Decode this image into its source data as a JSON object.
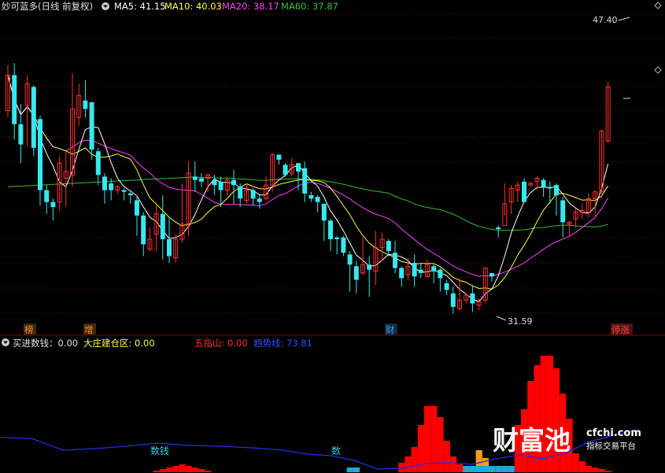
{
  "top_legend": {
    "title": "妙可蓝多(日线 前复权)",
    "ma5": "MA5: 41.15",
    "ma10": "MA10: 40.03",
    "ma20": "MA20: 38.17",
    "ma60": "MA60: 37.87"
  },
  "price_labels": {
    "high": "47.40",
    "low": "31.59"
  },
  "markers": [
    {
      "text": "榜",
      "color": "#ff8c2a"
    },
    {
      "text": "增",
      "color": "#ff8c2a"
    },
    {
      "text": "财",
      "color": "#3aa0ff"
    },
    {
      "text": "停涨",
      "color": "#ff4040"
    }
  ],
  "indicator_legend": {
    "main": "买进数钱：0.00",
    "zhuang": "大庄建仓区: 0.00",
    "wuzhi": "五指山: 0.00",
    "trend": "趋势线: 73.81"
  },
  "indicator_labels": {
    "shuqian1": "数钱",
    "shuqian2": "数"
  },
  "watermark": {
    "logo": "财富池",
    "site": "cfchi.com",
    "slogan": "指标交易平台"
  },
  "colors": {
    "up": "#ff3030",
    "down": "#36e8f0",
    "ma5": "#ffffff",
    "ma10": "#ffff40",
    "ma20": "#ff40ff",
    "ma60": "#30c030",
    "grid": "#8b0000",
    "trend": "#2030e0"
  },
  "chart_data": {
    "type": "candlestick",
    "ylim": [
      30.5,
      48.5
    ],
    "candles": [
      [
        42.8,
        44.9,
        42.4,
        45.5
      ],
      [
        44.9,
        42.0,
        41.1,
        45.6
      ],
      [
        42.0,
        40.8,
        39.7,
        43.2
      ],
      [
        43.1,
        44.4,
        40.7,
        44.9
      ],
      [
        44.2,
        40.6,
        40.1,
        44.3
      ],
      [
        42.3,
        38.1,
        37.2,
        42.5
      ],
      [
        38.1,
        37.4,
        36.7,
        38.4
      ],
      [
        37.4,
        37.1,
        36.3,
        37.6
      ],
      [
        37.4,
        39.7,
        36.9,
        40.1
      ],
      [
        38.8,
        39.2,
        37.1,
        40.4
      ],
      [
        39.0,
        42.9,
        38.3,
        45.0
      ],
      [
        42.4,
        43.7,
        41.9,
        44.4
      ],
      [
        43.4,
        42.9,
        42.4,
        44.6
      ],
      [
        43.3,
        40.5,
        39.9,
        43.3
      ],
      [
        40.4,
        39.0,
        38.4,
        40.6
      ],
      [
        38.9,
        38.1,
        37.3,
        39.1
      ],
      [
        38.5,
        38.1,
        37.5,
        38.8
      ],
      [
        38.1,
        38.3,
        37.9,
        38.4
      ],
      [
        38.1,
        38.0,
        37.5,
        38.2
      ],
      [
        37.9,
        37.8,
        37.3,
        38.1
      ],
      [
        37.5,
        36.6,
        35.4,
        37.7
      ],
      [
        36.6,
        34.9,
        34.2,
        36.8
      ],
      [
        34.6,
        35.2,
        34.5,
        35.9
      ],
      [
        35.5,
        36.7,
        34.5,
        37.2
      ],
      [
        36.7,
        35.2,
        34.0,
        37.8
      ],
      [
        35.2,
        34.2,
        33.8,
        36.5
      ],
      [
        34.1,
        35.2,
        33.8,
        35.5
      ],
      [
        35.2,
        36.1,
        35.0,
        38.5
      ],
      [
        36.0,
        39.1,
        35.4,
        39.8
      ],
      [
        38.9,
        38.7,
        38.0,
        39.8
      ],
      [
        38.8,
        38.6,
        38.3,
        39.1
      ],
      [
        38.8,
        39.0,
        38.0,
        39.1
      ],
      [
        38.7,
        38.4,
        37.8,
        39.0
      ],
      [
        38.6,
        38.1,
        37.1,
        38.9
      ],
      [
        38.1,
        38.7,
        37.8,
        38.9
      ],
      [
        38.7,
        38.4,
        37.3,
        39.3
      ],
      [
        38.3,
        37.6,
        37.1,
        38.5
      ],
      [
        37.5,
        38.1,
        37.3,
        38.5
      ],
      [
        38.1,
        37.6,
        37.2,
        38.2
      ],
      [
        37.6,
        37.4,
        37.0,
        37.8
      ],
      [
        37.6,
        38.4,
        37.5,
        38.9
      ],
      [
        38.4,
        40.2,
        38.0,
        40.3
      ],
      [
        40.2,
        39.9,
        39.6,
        40.2
      ],
      [
        39.6,
        39.0,
        38.9,
        39.7
      ],
      [
        39.1,
        39.6,
        38.9,
        40.0
      ],
      [
        39.7,
        39.2,
        38.1,
        39.5
      ],
      [
        39.4,
        37.9,
        37.4,
        39.8
      ],
      [
        37.8,
        37.6,
        37.4,
        38.0
      ],
      [
        37.7,
        37.4,
        36.8,
        37.8
      ],
      [
        37.3,
        36.3,
        35.1,
        37.2
      ],
      [
        36.3,
        35.2,
        34.5,
        36.4
      ],
      [
        35.3,
        35.2,
        34.3,
        35.4
      ],
      [
        35.3,
        34.4,
        34.2,
        35.4
      ],
      [
        34.3,
        33.7,
        32.1,
        34.5
      ],
      [
        33.6,
        32.8,
        32.0,
        33.9
      ],
      [
        33.2,
        33.7,
        33.1,
        35.3
      ],
      [
        33.7,
        33.4,
        31.8,
        34.2
      ],
      [
        33.3,
        34.7,
        32.5,
        35.7
      ],
      [
        34.7,
        35.2,
        33.9,
        35.6
      ],
      [
        35.1,
        34.5,
        34.2,
        35.2
      ],
      [
        34.4,
        33.5,
        33.2,
        35.1
      ],
      [
        33.5,
        32.9,
        32.4,
        33.6
      ],
      [
        33.1,
        33.6,
        32.8,
        34.1
      ],
      [
        33.8,
        33.0,
        32.4,
        34.3
      ],
      [
        33.4,
        33.2,
        32.9,
        33.8
      ],
      [
        33.0,
        33.7,
        32.9,
        34.0
      ],
      [
        33.6,
        33.3,
        32.6,
        33.7
      ],
      [
        33.4,
        32.9,
        32.1,
        33.5
      ],
      [
        32.6,
        32.2,
        31.9,
        32.8
      ],
      [
        32.0,
        31.2,
        30.8,
        32.4
      ],
      [
        31.1,
        31.6,
        31.0,
        32.9
      ],
      [
        31.6,
        31.9,
        31.4,
        32.0
      ],
      [
        32.0,
        31.4,
        30.9,
        32.5
      ],
      [
        31.3,
        31.5,
        31.0,
        31.7
      ],
      [
        31.6,
        33.5,
        31.4,
        33.5
      ],
      [
        33.2,
        33.0,
        32.7,
        33.2
      ],
      [
        35.9,
        35.8,
        35.3,
        36.0
      ],
      [
        36.0,
        37.3,
        36.6,
        38.5
      ],
      [
        37.4,
        38.2,
        36.7,
        38.4
      ],
      [
        38.1,
        38.4,
        37.4,
        38.6
      ],
      [
        38.6,
        37.4,
        37.5,
        38.8
      ],
      [
        38.4,
        38.5,
        38.3,
        38.6
      ],
      [
        38.6,
        38.8,
        38.1,
        38.9
      ],
      [
        38.7,
        38.3,
        37.7,
        38.8
      ],
      [
        38.3,
        38.2,
        37.3,
        38.6
      ],
      [
        38.4,
        37.8,
        36.6,
        38.5
      ],
      [
        37.5,
        36.2,
        35.3,
        37.7
      ],
      [
        36.1,
        36.2,
        35.4,
        36.3
      ],
      [
        36.4,
        36.8,
        35.9,
        37.0
      ],
      [
        36.8,
        36.9,
        36.4,
        37.3
      ],
      [
        36.8,
        37.6,
        36.5,
        37.9
      ],
      [
        37.6,
        38.0,
        36.5,
        38.1
      ],
      [
        38.0,
        41.6,
        37.6,
        41.7
      ],
      [
        41.0,
        44.2,
        40.9,
        44.5
      ]
    ],
    "ma5": [],
    "ma10": [],
    "ma20": [],
    "ma60": []
  },
  "indicator_data": {
    "red": [
      0,
      0,
      0,
      0,
      0,
      0,
      0,
      0,
      0,
      0,
      0,
      0,
      0,
      0,
      0,
      0,
      0,
      0,
      0,
      0,
      0,
      0,
      0,
      1,
      2,
      3,
      4,
      5,
      4,
      3,
      2,
      1,
      0,
      0,
      0,
      0,
      0,
      0,
      0,
      0,
      0,
      0,
      0,
      0,
      0,
      0,
      0,
      0,
      0,
      0,
      0,
      0,
      0,
      0,
      0,
      0,
      0,
      0,
      0,
      0,
      0,
      6,
      10,
      16,
      30,
      42,
      42,
      35,
      20,
      10,
      5,
      3,
      2,
      1,
      0,
      0,
      0,
      0,
      0,
      30,
      40,
      58,
      68,
      74,
      74,
      66,
      50,
      34,
      12,
      7,
      4,
      3,
      2,
      1,
      0,
      0,
      0,
      0,
      0,
      0,
      0
    ],
    "cyan": [
      0,
      0,
      0,
      0,
      0,
      0,
      0,
      0,
      0,
      0,
      0,
      0,
      0,
      0,
      0,
      0,
      0,
      0,
      0,
      0,
      0,
      0,
      0,
      0,
      0,
      0,
      0,
      0,
      0,
      0,
      0,
      0,
      0,
      0,
      0,
      0,
      0,
      0,
      0,
      0,
      0,
      0,
      0,
      0,
      0,
      0,
      0,
      0,
      0,
      0,
      0,
      0,
      0,
      3,
      3,
      0,
      0,
      0,
      0,
      0,
      0,
      0,
      0,
      0,
      0,
      0,
      0,
      0,
      0,
      0,
      0,
      4,
      4,
      4,
      4,
      4,
      4,
      4,
      4,
      0,
      0,
      0,
      0,
      0,
      0,
      0,
      0,
      0,
      0,
      0,
      0,
      0,
      0,
      0,
      0,
      0,
      0,
      0,
      0,
      0,
      0
    ],
    "orange": [
      0,
      0,
      0,
      0,
      0,
      0,
      0,
      0,
      0,
      0,
      0,
      0,
      0,
      0,
      0,
      0,
      0,
      0,
      0,
      0,
      0,
      0,
      0,
      0,
      0,
      0,
      0,
      0,
      0,
      0,
      0,
      0,
      0,
      0,
      0,
      0,
      0,
      0,
      0,
      0,
      0,
      0,
      0,
      0,
      0,
      0,
      0,
      0,
      0,
      0,
      0,
      0,
      0,
      0,
      0,
      0,
      0,
      0,
      0,
      0,
      0,
      0,
      0,
      0,
      0,
      0,
      0,
      0,
      0,
      0,
      0,
      0,
      0,
      14,
      9,
      0,
      0,
      0,
      0,
      0,
      0,
      0,
      0,
      0,
      0,
      0,
      0,
      0,
      0,
      0,
      0,
      0,
      0,
      0,
      0,
      0,
      0,
      0,
      0,
      0,
      0
    ]
  }
}
